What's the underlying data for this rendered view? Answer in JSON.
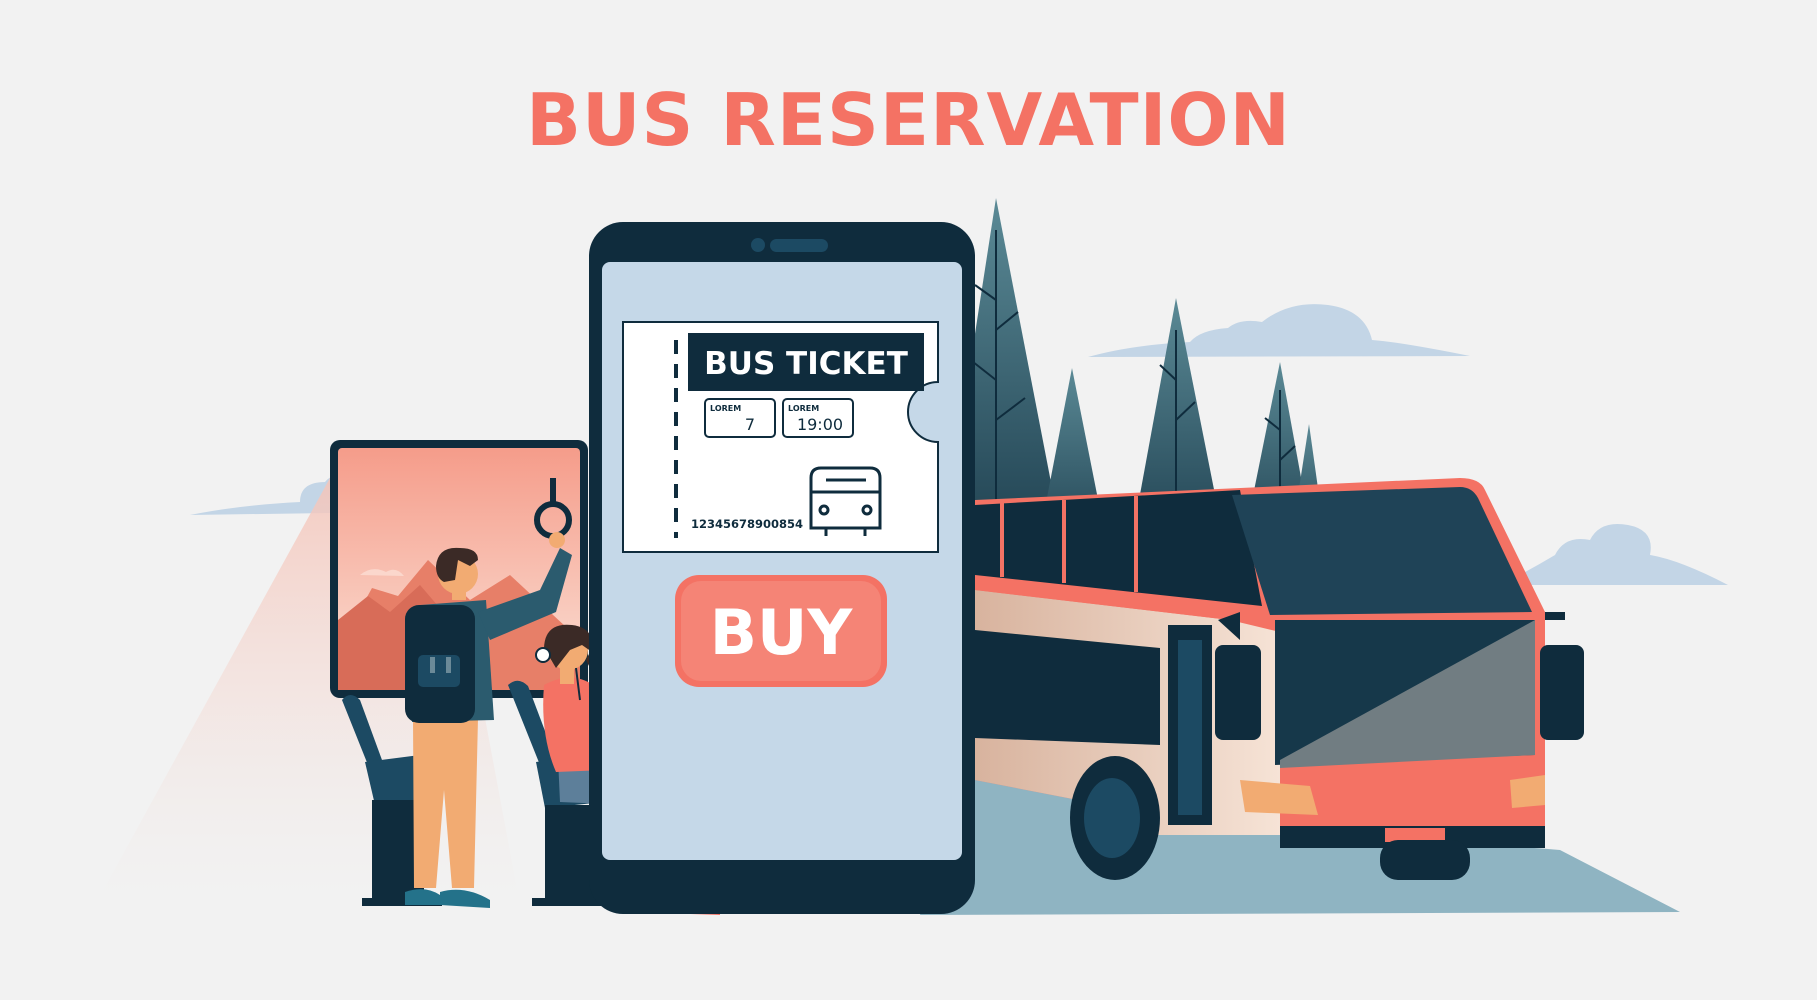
{
  "page": {
    "title": "BUS RESERVATION"
  },
  "ticket": {
    "title": "BUS TICKET",
    "field_1": {
      "label": "LOREM",
      "value": "7"
    },
    "field_2": {
      "label": "LOREM",
      "value": "19:00"
    },
    "serial_number": "12345678900854",
    "icon": "bus-icon"
  },
  "buy_button": {
    "label": "BUY",
    "color": "#f47264"
  },
  "colors": {
    "background": "#f2f2f2",
    "accent": "#f47264",
    "navy": "#0f2c3d",
    "phone_screen": "#c5d8e8",
    "bus_body": "#f47264",
    "trees": "#2f5566",
    "road": "#8fb4c2",
    "clouds": "#c3d5e6"
  }
}
